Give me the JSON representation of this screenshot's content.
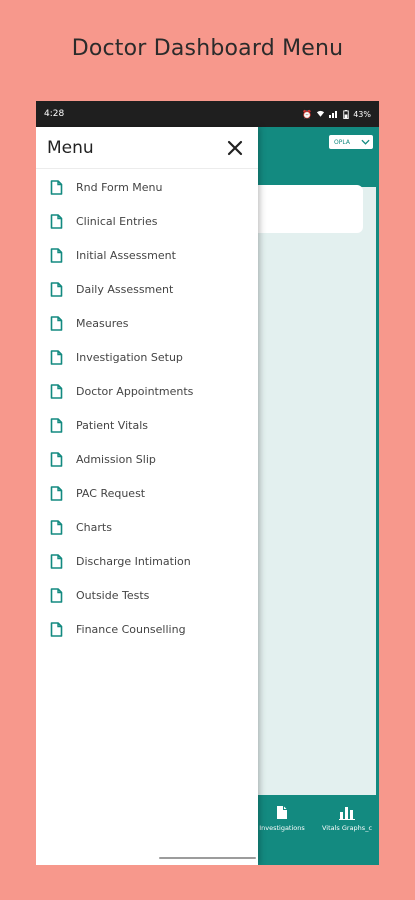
{
  "promo": {
    "title": "Doctor Dashboard Menu"
  },
  "status_bar": {
    "time": "4:28",
    "battery": "43%"
  },
  "app": {
    "spinner_value": "OPLA",
    "bottom_nav": [
      {
        "label": "Investigations",
        "icon": "document-icon"
      },
      {
        "label": "Vitals Graphs_c",
        "icon": "bar-chart-icon"
      }
    ]
  },
  "drawer": {
    "title": "Menu",
    "items": [
      {
        "label": "Rnd Form Menu"
      },
      {
        "label": "Clinical Entries"
      },
      {
        "label": "Initial Assessment"
      },
      {
        "label": "Daily Assessment"
      },
      {
        "label": "Measures"
      },
      {
        "label": "Investigation Setup"
      },
      {
        "label": "Doctor Appointments"
      },
      {
        "label": "Patient Vitals"
      },
      {
        "label": "Admission Slip"
      },
      {
        "label": "PAC Request"
      },
      {
        "label": "Charts"
      },
      {
        "label": "Discharge Intimation"
      },
      {
        "label": "Outside Tests"
      },
      {
        "label": "Finance Counselling"
      }
    ]
  },
  "colors": {
    "background": "#f7988c",
    "primary": "#138a80",
    "content": "#e3f0ef"
  }
}
